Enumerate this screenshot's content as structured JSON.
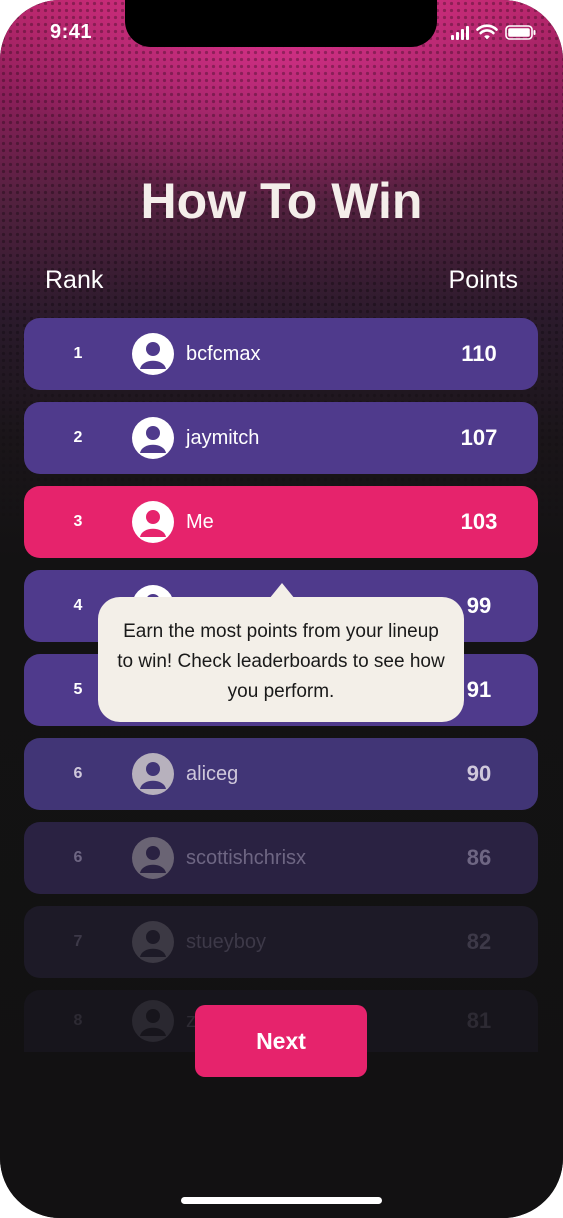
{
  "status_bar": {
    "time": "9:41"
  },
  "screen": {
    "title": "How To Win"
  },
  "table": {
    "rank_header": "Rank",
    "points_header": "Points",
    "rows": [
      {
        "rank": "1",
        "name": "bcfcmax",
        "points": "110"
      },
      {
        "rank": "2",
        "name": "jaymitch",
        "points": "107"
      },
      {
        "rank": "3",
        "name": "Me",
        "points": "103"
      },
      {
        "rank": "4",
        "name": "",
        "points": "99"
      },
      {
        "rank": "5",
        "name": "",
        "points": "91"
      },
      {
        "rank": "6",
        "name": "aliceg",
        "points": "90"
      },
      {
        "rank": "6",
        "name": "scottishchrisx",
        "points": "86"
      },
      {
        "rank": "7",
        "name": "stueyboy",
        "points": "82"
      },
      {
        "rank": "8",
        "name": "zi",
        "points": "81"
      }
    ]
  },
  "tooltip": {
    "text": "Earn the most points from your lineup to win! Check leaderboards to see how you perform."
  },
  "next_button": {
    "label": "Next"
  },
  "colors": {
    "highlight": "#e6236c",
    "row": "#4f3a8c",
    "background": "#121112"
  }
}
